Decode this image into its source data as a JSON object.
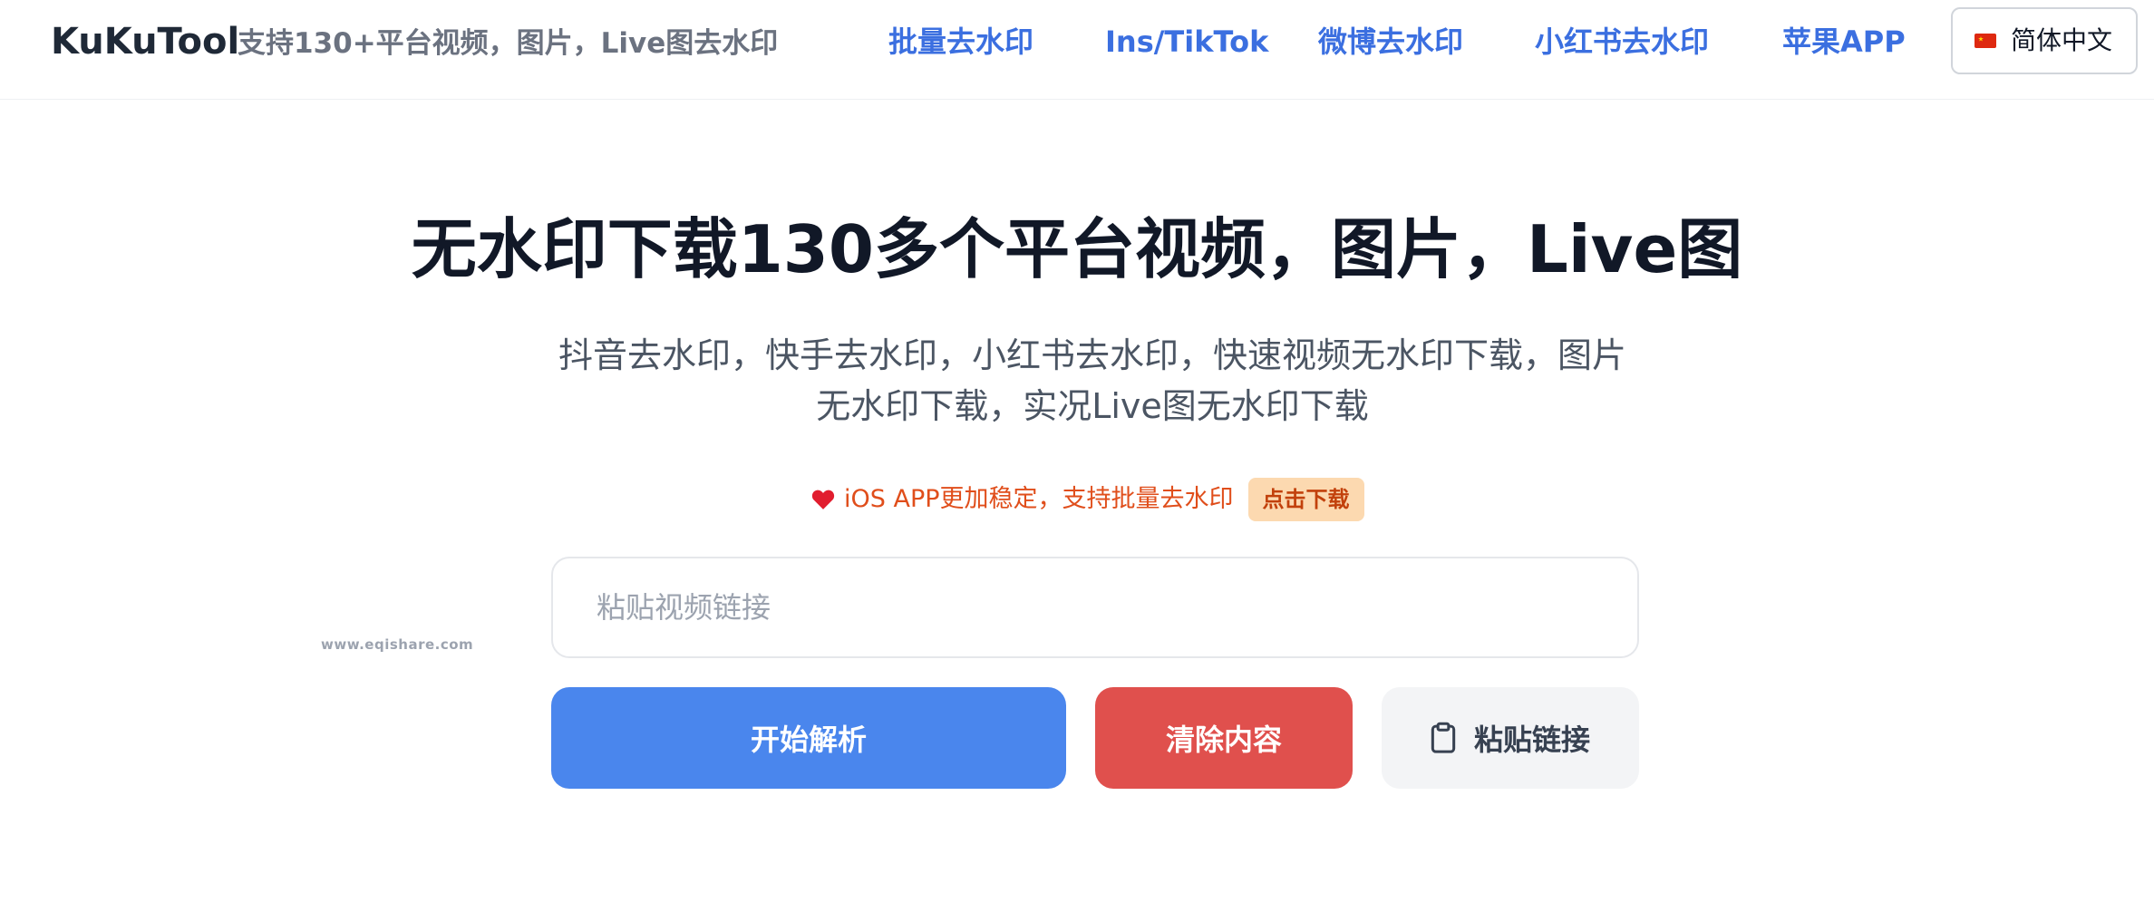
{
  "header": {
    "brand": "KuKuTool",
    "tagline": "支持130+平台视频，图片，Live图去水印",
    "nav": [
      {
        "label": "批量去水印"
      },
      {
        "label": "Ins/TikTok"
      },
      {
        "label": "微博去水印"
      },
      {
        "label": "小红书去水印"
      },
      {
        "label": "苹果APP"
      }
    ],
    "language": {
      "label": "简体中文",
      "flag_icon": "china-flag-icon"
    }
  },
  "hero": {
    "title": "无水印下载130多个平台视频，图片，Live图",
    "subtitle": "抖音去水印，快手去水印，小红书去水印，快速视频无水印下载，图片无水印下载，实况Live图无水印下载"
  },
  "promo": {
    "icon": "heart-icon",
    "text": "iOS APP更加稳定，支持批量去水印",
    "badge": "点击下载"
  },
  "search": {
    "placeholder": "粘贴视频链接",
    "value": ""
  },
  "watermark": "www.eqishare.com",
  "actions": {
    "parse_label": "开始解析",
    "clear_label": "清除内容",
    "paste_label": "粘贴链接",
    "paste_icon": "clipboard-icon"
  },
  "colors": {
    "nav": "#3b6fe0",
    "parse_button": "#4a86ed",
    "clear_button": "#e0504d",
    "paste_button": "#f3f4f6",
    "promo_text": "#e04e1b",
    "promo_badge_bg": "#fcd9b0"
  }
}
